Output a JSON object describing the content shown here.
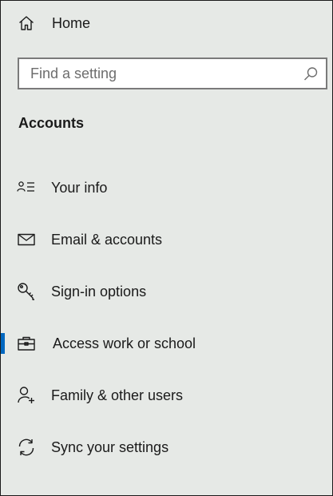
{
  "home": {
    "label": "Home",
    "icon": "home-icon"
  },
  "search": {
    "placeholder": "Find a setting",
    "value": "",
    "icon": "search-icon"
  },
  "section_title": "Accounts",
  "colors": {
    "background": "#e6e9e6",
    "accent": "#0067c0",
    "text": "#1a1a1a"
  },
  "nav_items": [
    {
      "label": "Your info",
      "icon": "contact-card-icon",
      "selected": false
    },
    {
      "label": "Email & accounts",
      "icon": "mail-icon",
      "selected": false
    },
    {
      "label": "Sign-in options",
      "icon": "key-icon",
      "selected": false
    },
    {
      "label": "Access work or school",
      "icon": "briefcase-icon",
      "selected": true
    },
    {
      "label": "Family & other users",
      "icon": "add-user-icon",
      "selected": false
    },
    {
      "label": "Sync your settings",
      "icon": "sync-icon",
      "selected": false
    }
  ]
}
